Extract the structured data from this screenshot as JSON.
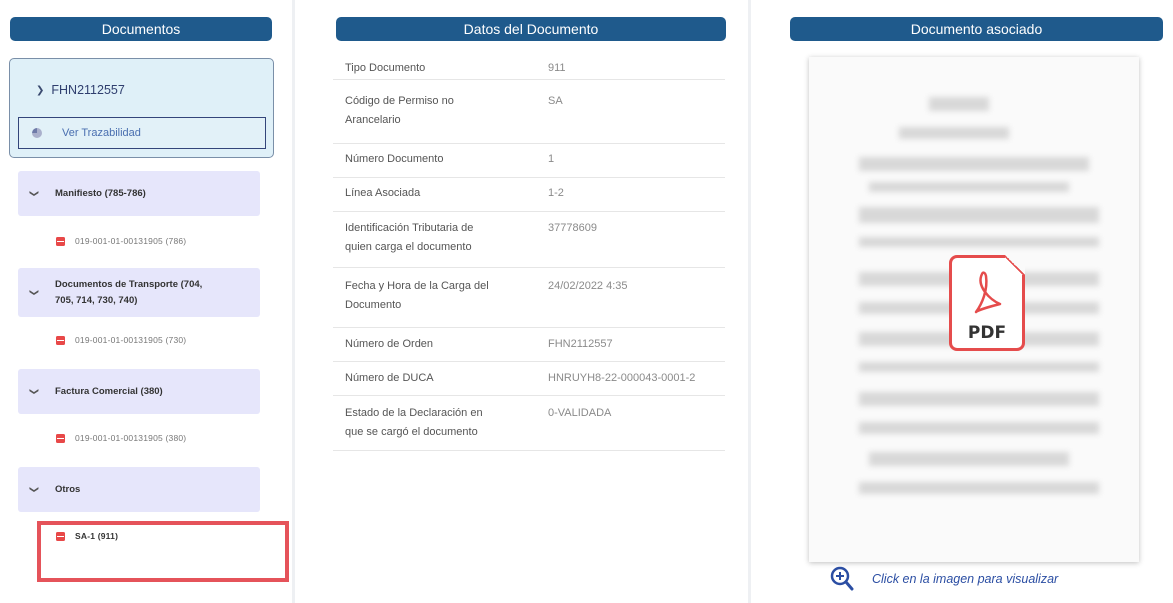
{
  "left": {
    "header": "Documentos",
    "order": {
      "number": "FHN2112557",
      "trace_label": "Ver Trazabilidad"
    },
    "groups": [
      {
        "label_line1": "Manifiesto (785-786)",
        "label_line2": "",
        "doc": "019-001-01-00131905 (786)"
      },
      {
        "label_line1": "Documentos de Transporte (704,",
        "label_line2": "705, 714, 730, 740)",
        "doc": "019-001-01-00131905 (730)"
      },
      {
        "label_line1": "Factura Comercial (380)",
        "label_line2": "",
        "doc": "019-001-01-00131905 (380)"
      },
      {
        "label_line1": "Otros",
        "label_line2": "",
        "doc": "SA-1 (911)"
      }
    ]
  },
  "middle": {
    "header": "Datos del Documento",
    "rows": [
      {
        "label": "Tipo Documento",
        "label2": "",
        "value": "911"
      },
      {
        "label": "Código de Permiso no",
        "label2": "Arancelario",
        "value": "SA"
      },
      {
        "label": "Número Documento",
        "label2": "",
        "value": "1"
      },
      {
        "label": "Línea Asociada",
        "label2": "",
        "value": "1-2"
      },
      {
        "label": "Identificación Tributaria de",
        "label2": "quien carga el documento",
        "value": "37778609"
      },
      {
        "label": "Fecha y Hora de la Carga del",
        "label2": "Documento",
        "value": "24/02/2022 4:35"
      },
      {
        "label": "Número de Orden",
        "label2": "",
        "value": "FHN2112557"
      },
      {
        "label": "Número de DUCA",
        "label2": "",
        "value": "HNRUYH8-22-000043-0001-2"
      },
      {
        "label": "Estado de la Declaración en",
        "label2": "que se cargó el documento",
        "value": "0-VALIDADA"
      }
    ]
  },
  "right": {
    "header": "Documento asociado",
    "pdf_badge": "PDF",
    "zoom_text": "Click en la imagen para visualizar"
  },
  "colors": {
    "header_bar": "#1f5a8c",
    "group_bg": "#e6e6fb",
    "highlight": "#e5535a",
    "pdf_red": "#e84848"
  },
  "icons": [
    "chevron-down-icon",
    "trace-pie-icon",
    "pdf-file-icon",
    "zoom-in-icon"
  ]
}
